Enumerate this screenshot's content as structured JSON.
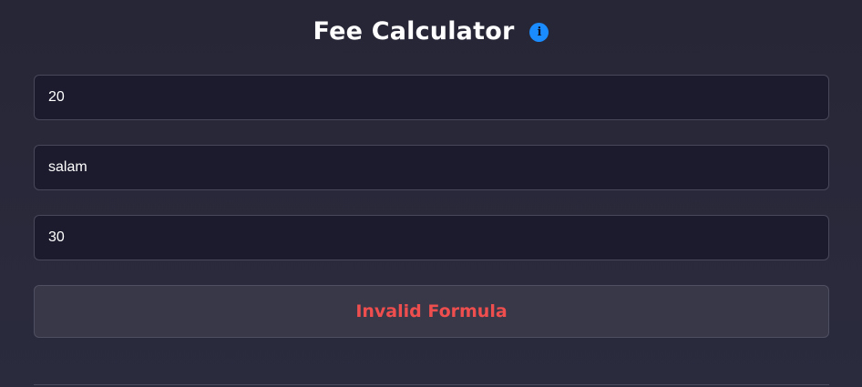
{
  "header": {
    "title": "Fee Calculator",
    "info_icon": "info-icon",
    "info_glyph": "i"
  },
  "form": {
    "fields": [
      {
        "value": "20"
      },
      {
        "value": "salam"
      },
      {
        "value": "30"
      }
    ]
  },
  "result": {
    "text": "Invalid Formula"
  },
  "colors": {
    "background": "#2b2b3e",
    "field_background": "#1b1b2d",
    "accent": "#1a8cff",
    "error": "#ef4e4e",
    "result_background": "#383848"
  }
}
